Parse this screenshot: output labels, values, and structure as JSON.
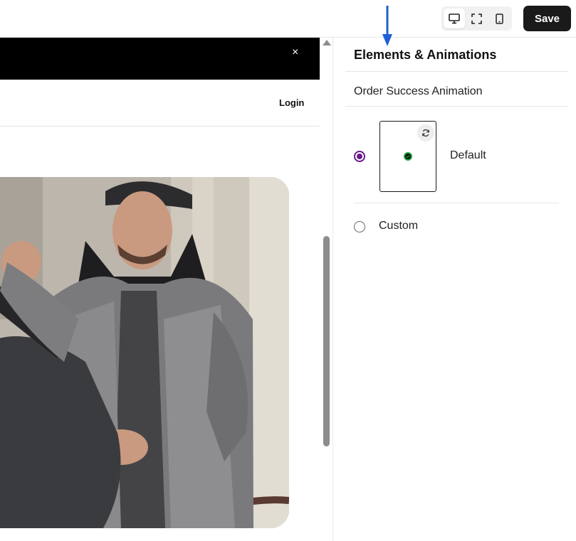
{
  "toolbar": {
    "devices": [
      {
        "name": "desktop",
        "icon": "monitor-icon",
        "active": true
      },
      {
        "name": "fullscreen",
        "icon": "expand-icon",
        "active": false
      },
      {
        "name": "mobile",
        "icon": "phone-icon",
        "active": false
      }
    ],
    "save_label": "Save"
  },
  "preview": {
    "announcement_close": "×",
    "login_label": "Login",
    "hero_image": "delivery-person-photo"
  },
  "panel": {
    "title": "Elements & Animations",
    "section_label": "Order Success Animation",
    "options": [
      {
        "label": "Default",
        "selected": true
      },
      {
        "label": "Custom",
        "selected": false
      }
    ]
  },
  "colors": {
    "accent": "#6b1a8a",
    "save_bg": "#1a1a1a",
    "arrow": "#1f5fd6",
    "success": "#22a843"
  }
}
